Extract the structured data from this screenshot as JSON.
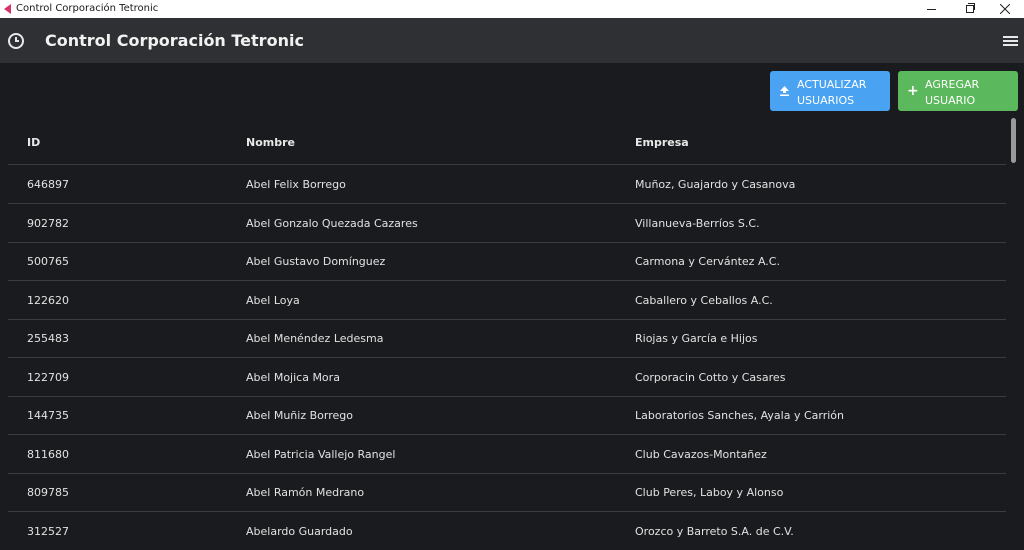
{
  "window": {
    "title": "Control Corporación Tetronic",
    "controls": {
      "minimize_icon": "minimize-icon",
      "maximize_icon": "restore-icon",
      "close_icon": "close-icon"
    }
  },
  "header": {
    "title": "Control Corporación Tetronic",
    "left_icon": "clock-icon",
    "right_icon": "menu-icon"
  },
  "actions": {
    "update_label": "ACTUALIZAR USUARIOS",
    "add_label": "AGREGAR USUARIO",
    "update_color": "#4aa3f2",
    "add_color": "#5cb85c"
  },
  "table": {
    "columns": [
      "ID",
      "Nombre",
      "Empresa"
    ],
    "rows": [
      {
        "id": "646897",
        "nombre": "Abel Felix Borrego",
        "empresa": "Muñoz, Guajardo y Casanova"
      },
      {
        "id": "902782",
        "nombre": "Abel Gonzalo Quezada Cazares",
        "empresa": "Villanueva-Berríos S.C."
      },
      {
        "id": "500765",
        "nombre": "Abel Gustavo Domínguez",
        "empresa": "Carmona y Cervántez A.C."
      },
      {
        "id": "122620",
        "nombre": "Abel Loya",
        "empresa": "Caballero y Ceballos A.C."
      },
      {
        "id": "255483",
        "nombre": "Abel Menéndez Ledesma",
        "empresa": "Riojas y García e Hijos"
      },
      {
        "id": "122709",
        "nombre": "Abel Mojica Mora",
        "empresa": "Corporacin Cotto y Casares"
      },
      {
        "id": "144735",
        "nombre": "Abel Muñiz Borrego",
        "empresa": "Laboratorios Sanches, Ayala y Carrión"
      },
      {
        "id": "811680",
        "nombre": "Abel Patricia Vallejo Rangel",
        "empresa": "Club Cavazos-Montañez"
      },
      {
        "id": "809785",
        "nombre": "Abel Ramón Medrano",
        "empresa": "Club Peres, Laboy y Alonso"
      },
      {
        "id": "312527",
        "nombre": "Abelardo Guardado",
        "empresa": "Orozco y Barreto S.A. de C.V."
      }
    ]
  }
}
